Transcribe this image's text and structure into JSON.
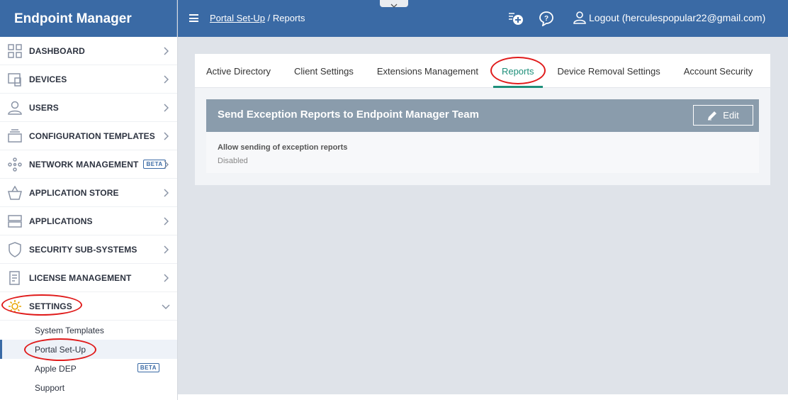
{
  "app": {
    "title": "Endpoint Manager"
  },
  "header": {
    "breadcrumb_parent": "Portal Set-Up",
    "breadcrumb_sep": "/",
    "breadcrumb_current": "Reports",
    "logout_label": "Logout (herculespopular22@gmail.com)"
  },
  "sidebar": {
    "items": [
      {
        "label": "DASHBOARD",
        "icon": "dashboard-icon"
      },
      {
        "label": "DEVICES",
        "icon": "devices-icon"
      },
      {
        "label": "USERS",
        "icon": "user-icon"
      },
      {
        "label": "CONFIGURATION TEMPLATES",
        "icon": "templates-icon"
      },
      {
        "label": "NETWORK MANAGEMENT",
        "icon": "network-icon",
        "badge": "BETA"
      },
      {
        "label": "APPLICATION STORE",
        "icon": "basket-icon"
      },
      {
        "label": "APPLICATIONS",
        "icon": "applications-icon"
      },
      {
        "label": "SECURITY SUB-SYSTEMS",
        "icon": "shield-icon"
      },
      {
        "label": "LICENSE MANAGEMENT",
        "icon": "license-icon"
      },
      {
        "label": "SETTINGS",
        "icon": "gear-icon"
      }
    ],
    "settings_sub": [
      {
        "label": "System Templates"
      },
      {
        "label": "Portal Set-Up"
      },
      {
        "label": "Apple DEP",
        "badge": "BETA"
      },
      {
        "label": "Support"
      }
    ]
  },
  "tabs": [
    {
      "label": "Active Directory"
    },
    {
      "label": "Client Settings"
    },
    {
      "label": "Extensions Management"
    },
    {
      "label": "Reports"
    },
    {
      "label": "Device Removal Settings"
    },
    {
      "label": "Account Security"
    }
  ],
  "card": {
    "title": "Send Exception Reports to Endpoint Manager Team",
    "edit_label": "Edit",
    "field_label": "Allow sending of exception reports",
    "field_value": "Disabled"
  },
  "colors": {
    "brand_blue": "#3a6aa5",
    "active_tab": "#1e8f7a",
    "annotation_red": "#e01b1b",
    "card_header": "#8a9cac"
  }
}
